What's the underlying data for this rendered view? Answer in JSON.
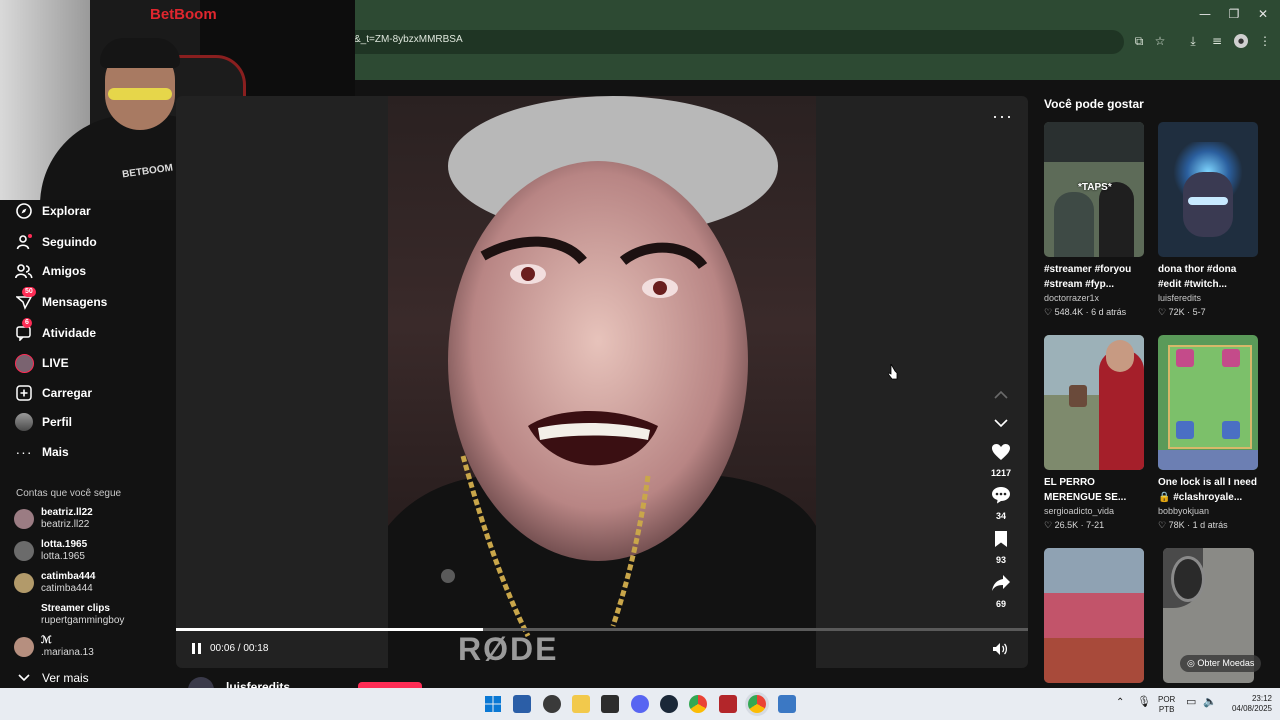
{
  "browser": {
    "url_fragment": "&_t=ZM-8ybzxMMRBSA"
  },
  "webcam": {
    "overlay_brand": "BetBoom",
    "shirt_brand": "BETBOOM"
  },
  "sidebar": {
    "items": [
      {
        "label": "Explorar",
        "icon": "compass-icon"
      },
      {
        "label": "Seguindo",
        "icon": "following-icon"
      },
      {
        "label": "Amigos",
        "icon": "friends-icon"
      },
      {
        "label": "Mensagens",
        "icon": "send-icon",
        "badge": "50"
      },
      {
        "label": "Atividade",
        "icon": "activity-icon",
        "badge": "6"
      },
      {
        "label": "LIVE",
        "icon": "live-icon"
      },
      {
        "label": "Carregar",
        "icon": "upload-icon"
      },
      {
        "label": "Perfil",
        "icon": "profile-icon"
      },
      {
        "label": "Mais",
        "icon": "more-icon"
      }
    ],
    "following_title": "Contas que você segue",
    "accounts": [
      {
        "name": "beatriz.ll22",
        "handle": "beatriz.ll22"
      },
      {
        "name": "lotta.1965",
        "handle": "lotta.1965"
      },
      {
        "name": "catimba444",
        "handle": "catimba444"
      },
      {
        "name": "Streamer clips",
        "handle": "rupertgammingboy"
      },
      {
        "name": "ℳ",
        "handle": ".mariana.13"
      }
    ],
    "see_more": "Ver mais"
  },
  "player": {
    "watermark": "RØDE",
    "time": "00:06 / 00:18",
    "progress": 0.36,
    "author": "luisferedits",
    "likes": "1217",
    "comments": "34",
    "saves": "93",
    "shares": "69"
  },
  "recommendations": {
    "title": "Você pode gostar",
    "cards": [
      {
        "caption": "#streamer #foryou #stream #fyp...",
        "author": "doctorrazer1x",
        "stats": "548.4K · 6 d atrás",
        "thumb_text": "*TAPS*",
        "bg": "#5d6b58"
      },
      {
        "caption": "dona thor #dona #edit #twitch...",
        "author": "luisferedits",
        "stats": "72K · 5-7",
        "thumb_text": "",
        "bg": "#1f2e3f"
      },
      {
        "caption": "EL PERRO MERENGUE SE...",
        "author": "sergioadicto_vida",
        "stats": "26.5K · 7-21",
        "thumb_text": "",
        "bg": "#7e8a6d"
      },
      {
        "caption": "One lock is all I need 🔒 #clashroyale...",
        "author": "bobbyokjuan",
        "stats": "78K · 1 d atrás",
        "thumb_text": "",
        "bg": "#5a9a59"
      },
      {
        "caption": "",
        "author": "",
        "stats": "",
        "thumb_text": "",
        "bg": "#6a6f73"
      },
      {
        "caption": "",
        "author": "",
        "stats": "",
        "thumb_text": "",
        "bg": "#8a8a86"
      }
    ],
    "coins_button": "Obter Moedas"
  },
  "taskbar": {
    "lang": "POR",
    "layout": "PTB",
    "time": "23:12",
    "date": "04/08/2025"
  }
}
